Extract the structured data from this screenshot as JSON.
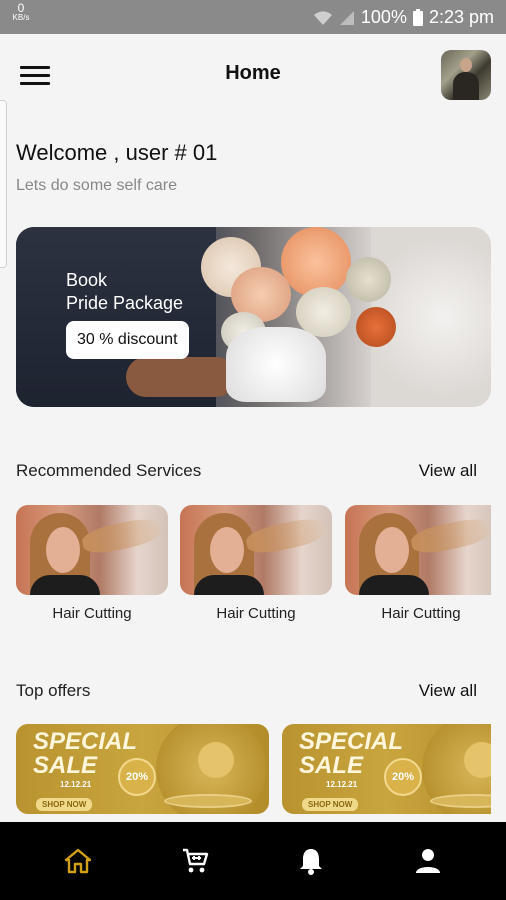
{
  "status_bar": {
    "data_rate": "0",
    "data_unit": "KB/s",
    "battery": "100%",
    "time": "2:23 pm"
  },
  "header": {
    "title": "Home",
    "menu_icon": "hamburger-menu-icon",
    "avatar_icon": "user-avatar"
  },
  "welcome": {
    "greeting": "Welcome , user # 01",
    "subtitle": "Lets do some self care"
  },
  "banner": {
    "line1": "Book",
    "line2": "Pride Package",
    "discount": "30 % discount"
  },
  "recommended": {
    "title": "Recommended Services",
    "view_all": "View all",
    "items": [
      {
        "label": "Hair Cutting"
      },
      {
        "label": "Hair Cutting"
      },
      {
        "label": "Hair Cutting"
      }
    ]
  },
  "offers": {
    "title": "Top offers",
    "view_all": "View all",
    "items": [
      {
        "title_1": "SPECIAL",
        "title_2": "SALE",
        "date": "12.12.21",
        "percent": "20%",
        "button": "SHOP NOW"
      },
      {
        "title_1": "SPECIAL",
        "title_2": "SALE",
        "date": "12.12.21",
        "percent": "20%",
        "button": "SHOP NOW"
      }
    ]
  },
  "bottom_nav": {
    "items": [
      {
        "icon": "home-icon",
        "active": true
      },
      {
        "icon": "cart-icon",
        "active": false
      },
      {
        "icon": "bell-icon",
        "active": false
      },
      {
        "icon": "profile-icon",
        "active": false
      }
    ],
    "active_color": "#d4a017",
    "inactive_color": "#ffffff"
  }
}
